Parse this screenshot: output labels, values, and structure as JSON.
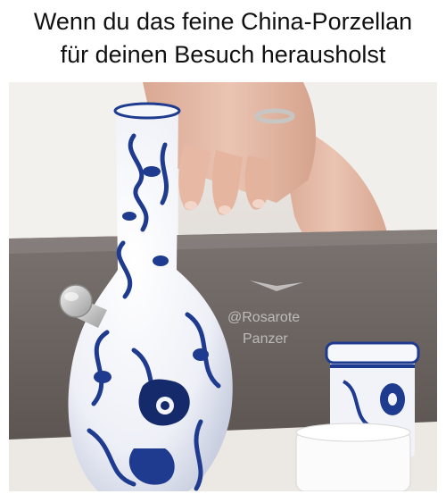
{
  "caption": {
    "line1": "Wenn du das feine China-Porzellan",
    "line2": "für deinen Besuch herausholst"
  },
  "watermark": {
    "handle": "@Rosarote",
    "name": "Panzer"
  },
  "colors": {
    "porcelain": "#f4f5fa",
    "cobalt": "#1f3b8f",
    "cobalt_dark": "#152a6b",
    "table": "#e8e4df",
    "upholstery": "#6b6461",
    "skin": "#e6b9a4"
  }
}
